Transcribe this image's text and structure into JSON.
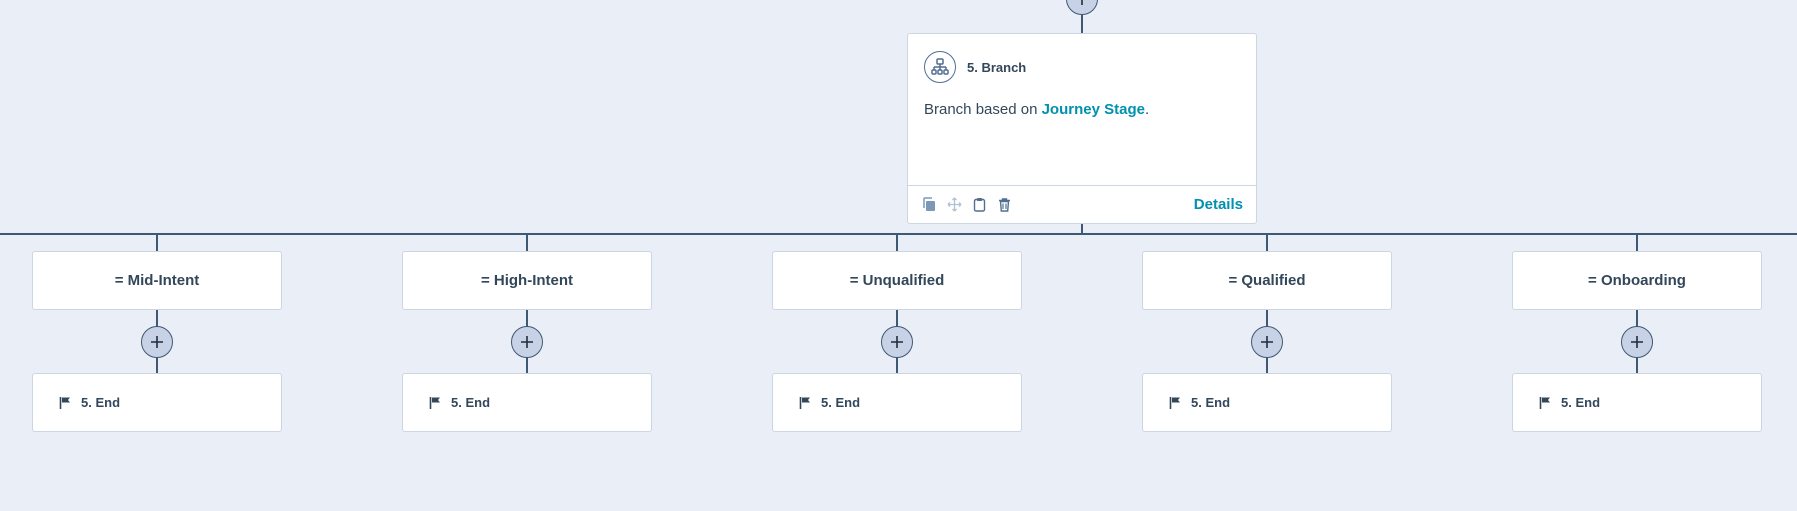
{
  "branch": {
    "title": "5. Branch",
    "desc_prefix": "Branch based on ",
    "desc_link": "Journey Stage",
    "desc_suffix": ".",
    "details_label": "Details",
    "icon": "branch-icon"
  },
  "branches": [
    {
      "condition": "= Mid-Intent",
      "end_label": "5. End"
    },
    {
      "condition": "= High-Intent",
      "end_label": "5. End"
    },
    {
      "condition": "= Unqualified",
      "end_label": "5. End"
    },
    {
      "condition": "= Qualified",
      "end_label": "5. End"
    },
    {
      "condition": "= Onboarding",
      "end_label": "5. End"
    }
  ],
  "toolbar_icons": [
    "clone-icon",
    "move-icon",
    "clipboard-icon",
    "trash-icon"
  ],
  "colors": {
    "background": "#eaeef7",
    "connector": "#3f5873",
    "link": "#0091ae",
    "text": "#33475b",
    "plus_fill": "#c7d2e6"
  }
}
